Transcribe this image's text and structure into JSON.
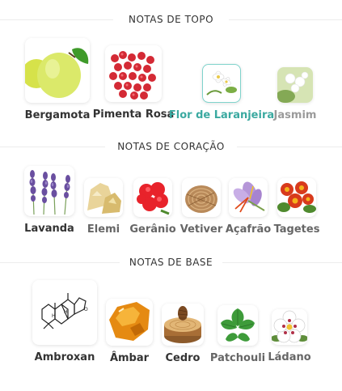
{
  "sections": [
    {
      "title": "NOTAS DE TOPO",
      "notes": [
        {
          "name": "Bergamota",
          "state": "normal"
        },
        {
          "name": "Pimenta Rosa",
          "state": "normal"
        },
        {
          "name": "Flor de Laranjeira",
          "state": "selected"
        },
        {
          "name": "Jasmim",
          "state": "faded"
        }
      ]
    },
    {
      "title": "NOTAS DE CORAÇÃO",
      "notes": [
        {
          "name": "Lavanda",
          "state": "normal"
        },
        {
          "name": "Elemi",
          "state": "dim"
        },
        {
          "name": "Gerânio",
          "state": "dim"
        },
        {
          "name": "Vetiver",
          "state": "dim"
        },
        {
          "name": "Açafrão",
          "state": "dim"
        },
        {
          "name": "Tagetes",
          "state": "dim"
        }
      ]
    },
    {
      "title": "NOTAS DE BASE",
      "notes": [
        {
          "name": "Ambroxan",
          "state": "normal"
        },
        {
          "name": "Âmbar",
          "state": "normal"
        },
        {
          "name": "Cedro",
          "state": "normal"
        },
        {
          "name": "Patchouli",
          "state": "dim"
        },
        {
          "name": "Ládano",
          "state": "dim"
        }
      ]
    }
  ],
  "colors": {
    "accent": "#3aa9a0",
    "selected_border": "#7fd3cc",
    "text": "#333333",
    "divider": "#ececec"
  }
}
